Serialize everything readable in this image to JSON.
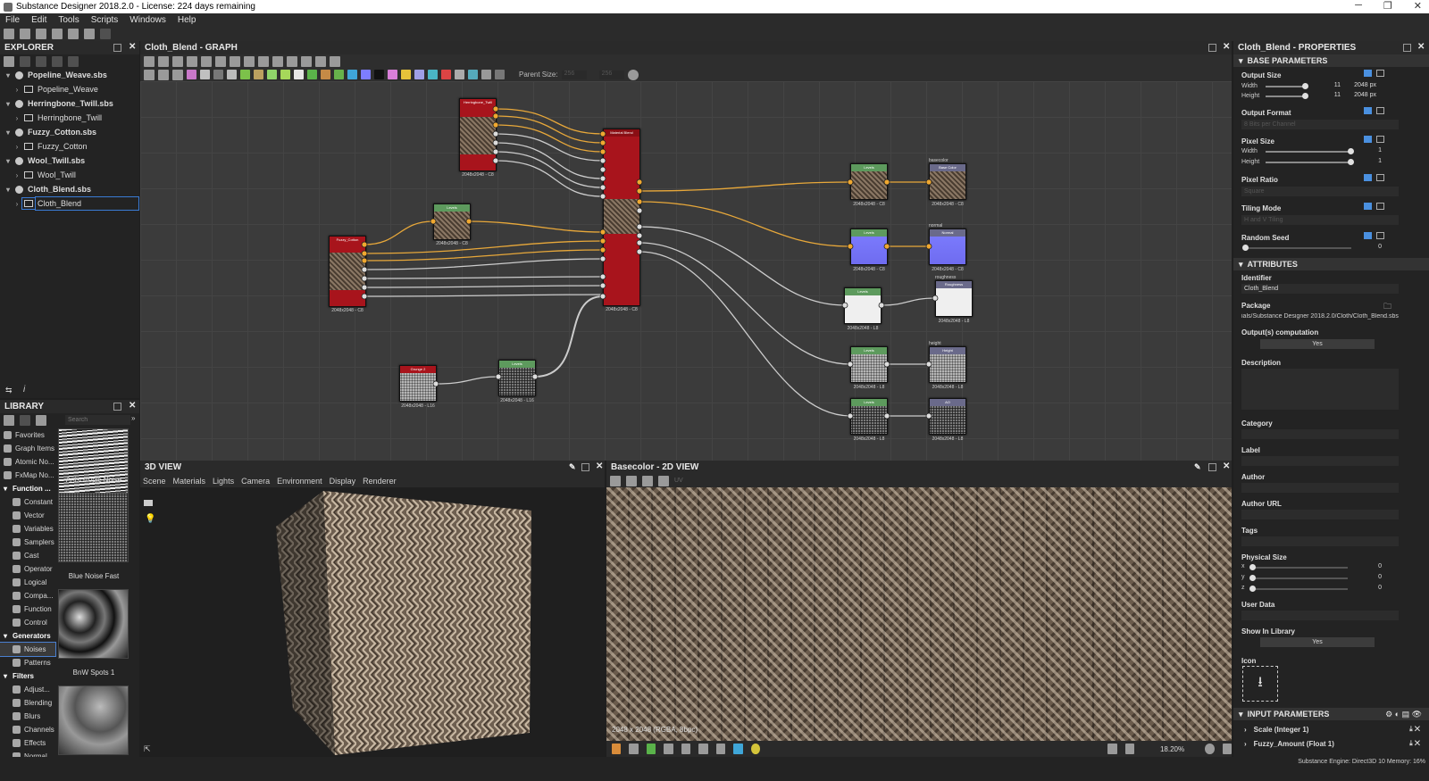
{
  "window": {
    "title": "Substance Designer 2018.2.0 - License: 224 days remaining",
    "controls": [
      "─",
      "❐",
      "✕"
    ]
  },
  "menu": [
    "File",
    "Edit",
    "Tools",
    "Scripts",
    "Windows",
    "Help"
  ],
  "explorer": {
    "title": "EXPLORER",
    "items": [
      {
        "label": "Popeline_Weave.sbs",
        "type": "package"
      },
      {
        "label": "Popeline_Weave",
        "type": "graph"
      },
      {
        "label": "Herringbone_Twill.sbs",
        "type": "package"
      },
      {
        "label": "Herringbone_Twill",
        "type": "graph"
      },
      {
        "label": "Fuzzy_Cotton.sbs",
        "type": "package"
      },
      {
        "label": "Fuzzy_Cotton",
        "type": "graph"
      },
      {
        "label": "Wool_Twill.sbs",
        "type": "package"
      },
      {
        "label": "Wool_Twill",
        "type": "graph"
      },
      {
        "label": "Cloth_Blend.sbs",
        "type": "package"
      },
      {
        "label": "Cloth_Blend",
        "type": "graph",
        "selected": true
      }
    ]
  },
  "library": {
    "title": "LIBRARY",
    "search_placeholder": "Search",
    "categories": [
      {
        "label": "Favorites",
        "kind": "item"
      },
      {
        "label": "Graph Items",
        "kind": "item"
      },
      {
        "label": "Atomic No...",
        "kind": "item"
      },
      {
        "label": "FxMap No...",
        "kind": "item"
      },
      {
        "label": "Function ...",
        "kind": "header"
      },
      {
        "label": "Constant",
        "kind": "sub"
      },
      {
        "label": "Vector",
        "kind": "sub"
      },
      {
        "label": "Variables",
        "kind": "sub"
      },
      {
        "label": "Samplers",
        "kind": "sub"
      },
      {
        "label": "Cast",
        "kind": "sub"
      },
      {
        "label": "Operator",
        "kind": "sub"
      },
      {
        "label": "Logical",
        "kind": "sub"
      },
      {
        "label": "Compa...",
        "kind": "sub"
      },
      {
        "label": "Function",
        "kind": "sub"
      },
      {
        "label": "Control",
        "kind": "sub"
      },
      {
        "label": "Generators",
        "kind": "header"
      },
      {
        "label": "Noises",
        "kind": "sub",
        "selected": true
      },
      {
        "label": "Patterns",
        "kind": "sub"
      },
      {
        "label": "Filters",
        "kind": "header"
      },
      {
        "label": "Adjust...",
        "kind": "sub"
      },
      {
        "label": "Blending",
        "kind": "sub"
      },
      {
        "label": "Blurs",
        "kind": "sub"
      },
      {
        "label": "Channels",
        "kind": "sub"
      },
      {
        "label": "Effects",
        "kind": "sub"
      },
      {
        "label": "Normal",
        "kind": "sub"
      }
    ],
    "thumbnails": [
      "Anisotropic Noise",
      "Blue Noise Fast",
      "BnW Spots 1"
    ]
  },
  "graph": {
    "title": "Cloth_Blend - GRAPH",
    "parent_size_label": "Parent Size:",
    "parent_size_value": "256",
    "ratio_value": "256",
    "nodes": {
      "herringbone": {
        "title": "Herringbone_Twill",
        "res": "2048x2048 - C8"
      },
      "material_blend": {
        "title": "Material Blend",
        "res": "2048x2048 - C8"
      },
      "fuzzy_cotton": {
        "title": "Fuzzy_Cotton",
        "res": "2048x2048 - C8"
      },
      "levels_tan": {
        "title": "Levels",
        "res": "2048x2048 - C8"
      },
      "grunge": {
        "title": "Grunge 2",
        "res": "2048x2048 - L16"
      },
      "levels_noise": {
        "title": "Levels",
        "res": "2048x2048 - L16"
      },
      "levels_base": {
        "title": "Levels",
        "res": "2048x2048 - C8"
      },
      "out_basecolor": {
        "title": "Base Color",
        "tag": "basecolor",
        "res": "2048x2048 - C8"
      },
      "levels_normal": {
        "title": "Levels",
        "res": "2048x2048 - C8"
      },
      "out_normal": {
        "title": "Normal",
        "tag": "normal",
        "res": "2048x2048 - C8"
      },
      "levels_rough": {
        "title": "Levels",
        "res": "2048x2048 - L8"
      },
      "out_roughness": {
        "title": "Roughness",
        "tag": "roughness",
        "res": "2048x2048 - L8"
      },
      "levels_height": {
        "title": "Levels",
        "res": "2048x2048 - L8"
      },
      "out_height": {
        "title": "Height",
        "tag": "height",
        "res": "2048x2048 - L8"
      },
      "levels_ao": {
        "title": "Levels",
        "res": "2048x2048 - L8"
      },
      "out_ao": {
        "title": "AO",
        "tag": "ao",
        "res": "2048x2048 - L8"
      }
    }
  },
  "view3d": {
    "title": "3D VIEW",
    "tabs": [
      "Scene",
      "Materials",
      "Lights",
      "Camera",
      "Environment",
      "Display",
      "Renderer"
    ]
  },
  "view2d": {
    "title": "Basecolor - 2D VIEW",
    "channel": "UV",
    "info": "2048 x 2048 (RGBA, 8bpc)",
    "zoom": "18.20%"
  },
  "properties": {
    "title": "Cloth_Blend - PROPERTIES",
    "base_section": "BASE PARAMETERS",
    "output_size": {
      "label": "Output Size",
      "width_label": "Width",
      "height_label": "Height",
      "width_num": "11",
      "height_num": "11",
      "width_px": "2048 px",
      "height_px": "2048 px"
    },
    "output_format": {
      "label": "Output Format",
      "value": "8 Bits per Channel"
    },
    "pixel_size": {
      "label": "Pixel Size",
      "width_label": "Width",
      "height_label": "Height",
      "width_val": "1",
      "height_val": "1"
    },
    "pixel_ratio": {
      "label": "Pixel Ratio",
      "value": "Square"
    },
    "tiling_mode": {
      "label": "Tiling Mode",
      "value": "H and V Tiling"
    },
    "random_seed": {
      "label": "Random Seed",
      "value": "0"
    },
    "attr_section": "ATTRIBUTES",
    "identifier": {
      "label": "Identifier",
      "value": "Cloth_Blend"
    },
    "package": {
      "label": "Package",
      "value": "ials/Substance Designer 2018.2.0/Cloth/Cloth_Blend.sbs"
    },
    "outputs_computation": {
      "label": "Output(s) computation",
      "value": "Yes"
    },
    "description": {
      "label": "Description"
    },
    "category": {
      "label": "Category"
    },
    "label": {
      "label": "Label"
    },
    "author": {
      "label": "Author"
    },
    "author_url": {
      "label": "Author URL"
    },
    "tags": {
      "label": "Tags"
    },
    "physical_size": {
      "label": "Physical Size",
      "x_label": "x",
      "y_label": "y",
      "z_label": "z",
      "x": "0",
      "y": "0",
      "z": "0"
    },
    "user_data": {
      "label": "User Data"
    },
    "show_in_library": {
      "label": "Show In Library",
      "value": "Yes"
    },
    "icon": {
      "label": "Icon"
    },
    "input_section": "INPUT PARAMETERS",
    "inputs": [
      "Scale (Integer 1)",
      "Fuzzy_Amount (Float 1)"
    ]
  },
  "status": {
    "engine": "Substance Engine: Direct3D 10  Memory: 16%"
  }
}
